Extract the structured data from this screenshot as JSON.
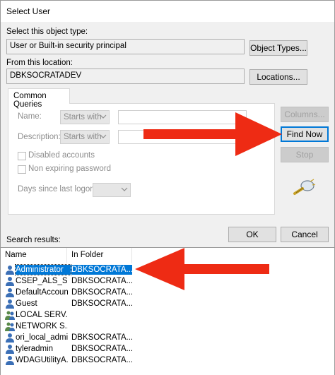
{
  "window": {
    "title": "Select User"
  },
  "object_type": {
    "label": "Select this object type:",
    "value": "User or Built-in security principal",
    "button": "Object Types..."
  },
  "location": {
    "label": "From this location:",
    "value": "DBKSOCRATADEV",
    "button": "Locations..."
  },
  "queries": {
    "tab": "Common Queries",
    "name_label": "Name:",
    "name_mode": "Starts with",
    "description_label": "Description:",
    "description_mode": "Starts with",
    "disabled_accounts": "Disabled accounts",
    "non_expiring_password": "Non expiring password",
    "days_label": "Days since last logon:",
    "columns_button": "Columns...",
    "find_button": "Find Now",
    "stop_button": "Stop"
  },
  "ok_button": "OK",
  "cancel_button": "Cancel",
  "results": {
    "label": "Search results:",
    "columns": [
      "Name",
      "In Folder"
    ],
    "rows": [
      {
        "name": "Administrator",
        "folder": "DBKSOCRATA...",
        "icon": "user-icon"
      },
      {
        "name": "CSEP_ALS_S...",
        "folder": "DBKSOCRATA...",
        "icon": "user-icon"
      },
      {
        "name": "DefaultAccount",
        "folder": "DBKSOCRATA...",
        "icon": "user-icon"
      },
      {
        "name": "Guest",
        "folder": "DBKSOCRATA...",
        "icon": "user-icon"
      },
      {
        "name": "LOCAL SERV...",
        "folder": "",
        "icon": "group-icon"
      },
      {
        "name": "NETWORK S...",
        "folder": "",
        "icon": "group-icon"
      },
      {
        "name": "ori_local_admin",
        "folder": "DBKSOCRATA...",
        "icon": "user-icon"
      },
      {
        "name": "tyleradmin",
        "folder": "DBKSOCRATA...",
        "icon": "user-icon"
      },
      {
        "name": "WDAGUtilityA...",
        "folder": "DBKSOCRATA...",
        "icon": "user-icon"
      }
    ]
  },
  "colors": {
    "arrow": "#ee2b14",
    "selection": "#0078d7"
  }
}
